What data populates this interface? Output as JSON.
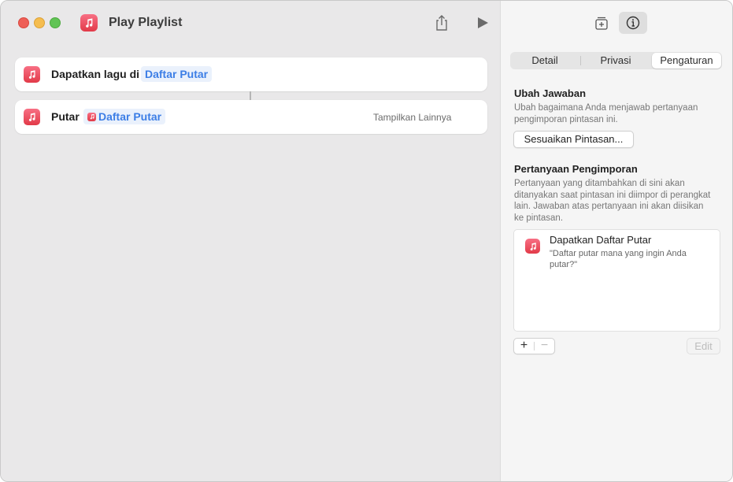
{
  "window": {
    "title": "Play Playlist"
  },
  "workflow": {
    "actions": [
      {
        "label": "Dapatkan lagu di",
        "token": "Daftar Putar"
      },
      {
        "label": "Putar",
        "token": "Daftar Putar",
        "show_more": "Tampilkan Lainnya"
      }
    ]
  },
  "inspector": {
    "tabs": [
      "Detail",
      "Privasi",
      "Pengaturan"
    ],
    "selected_tab": "Pengaturan",
    "change_answers": {
      "heading": "Ubah Jawaban",
      "description": "Ubah bagaimana Anda menjawab pertanyaan pengimporan pintasan ini.",
      "button": "Sesuaikan Pintasan..."
    },
    "import_questions": {
      "heading": "Pertanyaan Pengimporan",
      "description": "Pertanyaan yang ditambahkan di sini akan ditanyakan saat pintasan ini diimpor di perangkat lain. Jawaban atas pertanyaan ini akan diisikan ke pintasan.",
      "items": [
        {
          "title": "Dapatkan Daftar Putar",
          "question": "\"Daftar putar mana yang ingin Anda putar?\""
        }
      ],
      "add_label": "+",
      "remove_label": "−",
      "edit_label": "Edit"
    }
  },
  "icons": {
    "app": "music-note-icon",
    "share": "share-icon",
    "run": "play-icon",
    "library": "add-to-library-icon",
    "info": "info-icon"
  },
  "colors": {
    "music_red": "#e23a48",
    "token_blue": "#3c7ee6"
  }
}
